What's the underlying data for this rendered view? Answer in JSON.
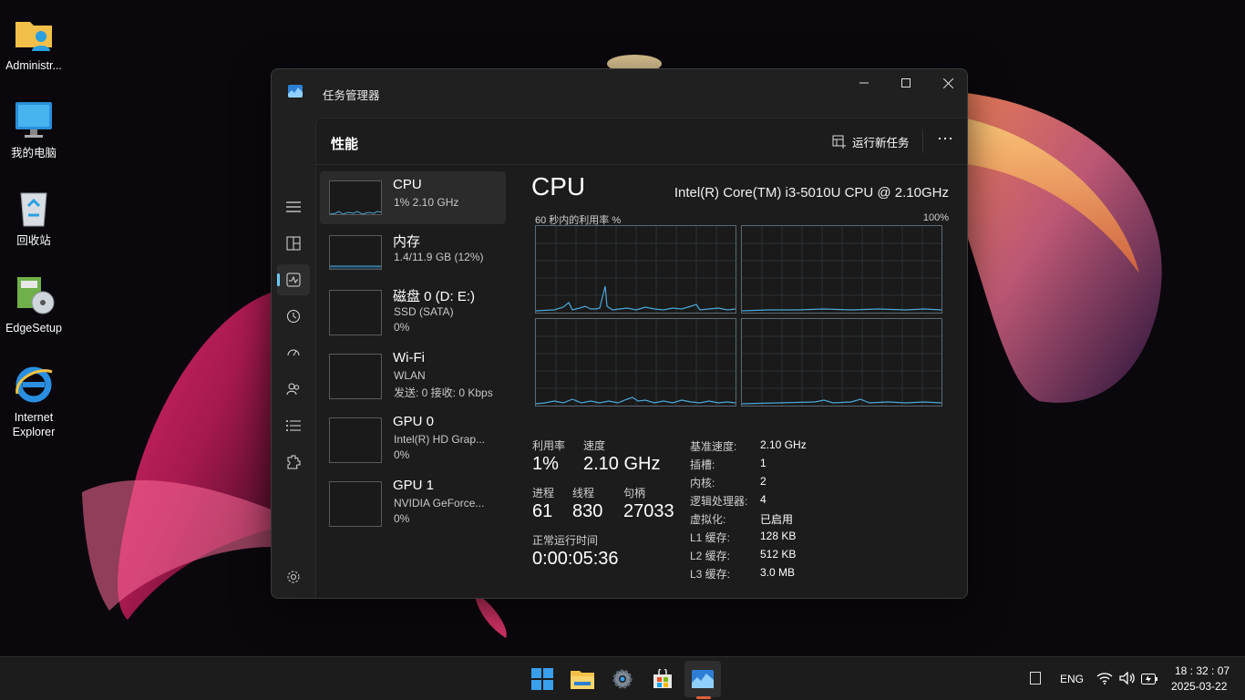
{
  "desktop": {
    "icons": [
      {
        "label": "Administr...",
        "icon": "user-folder-icon"
      },
      {
        "label": "我的电脑",
        "icon": "computer-icon"
      },
      {
        "label": "回收站",
        "icon": "recycle-bin-icon"
      },
      {
        "label": "EdgeSetup",
        "icon": "installer-icon"
      },
      {
        "label": "Internet Explorer",
        "icon": "internet-explorer-icon"
      }
    ]
  },
  "window": {
    "title": "任务管理器",
    "controls": {
      "minimize": "—",
      "maximize": "☐",
      "close": "✕"
    }
  },
  "header": {
    "page_title": "性能",
    "run_new_task": "运行新任务",
    "more": "···"
  },
  "nav": {
    "items": [
      "hamburger-icon",
      "processes-icon",
      "performance-icon",
      "app-history-icon",
      "startup-icon",
      "users-icon",
      "details-icon",
      "services-icon",
      "settings-icon"
    ],
    "active": "performance-icon"
  },
  "perf_list": [
    {
      "title": "CPU",
      "line1": "1% 2.10 GHz"
    },
    {
      "title": "内存",
      "line1": "1.4/11.9 GB (12%)"
    },
    {
      "title": "磁盘 0 (D: E:)",
      "line1": "SSD (SATA)",
      "line2": "0%"
    },
    {
      "title": "Wi-Fi",
      "line1": "WLAN",
      "line2": "发送: 0 接收: 0 Kbps"
    },
    {
      "title": "GPU 0",
      "line1": "Intel(R) HD Grap...",
      "line2": "0%"
    },
    {
      "title": "GPU 1",
      "line1": "NVIDIA GeForce...",
      "line2": "0%"
    }
  ],
  "detail": {
    "title": "CPU",
    "model": "Intel(R) Core(TM) i3-5010U CPU @ 2.10GHz",
    "util_label": "60 秒内的利用率 %",
    "util_max": "100%",
    "stats": {
      "utilization_label": "利用率",
      "utilization": "1%",
      "speed_label": "速度",
      "speed": "2.10 GHz",
      "processes_label": "进程",
      "processes": "61",
      "threads_label": "线程",
      "threads": "830",
      "handles_label": "句柄",
      "handles": "27033",
      "uptime_label": "正常运行时间",
      "uptime": "0:00:05:36"
    },
    "specs": [
      {
        "k": "基准速度:",
        "v": "2.10 GHz"
      },
      {
        "k": "插槽:",
        "v": "1"
      },
      {
        "k": "内核:",
        "v": "2"
      },
      {
        "k": "逻辑处理器:",
        "v": "4"
      },
      {
        "k": "虚拟化:",
        "v": "已启用"
      },
      {
        "k": "L1 缓存:",
        "v": "128 KB"
      },
      {
        "k": "L2 缓存:",
        "v": "512 KB"
      },
      {
        "k": "L3 缓存:",
        "v": "3.0 MB"
      }
    ]
  },
  "colors": {
    "graph_line": "#4aa8d8",
    "accent": "#6ccbf5"
  },
  "taskbar": {
    "apps": [
      "start-icon",
      "file-explorer-icon",
      "settings-icon",
      "store-icon",
      "task-manager-icon"
    ],
    "language": "ENG",
    "time": "18 : 32 : 07",
    "date": "2025-03-22"
  }
}
